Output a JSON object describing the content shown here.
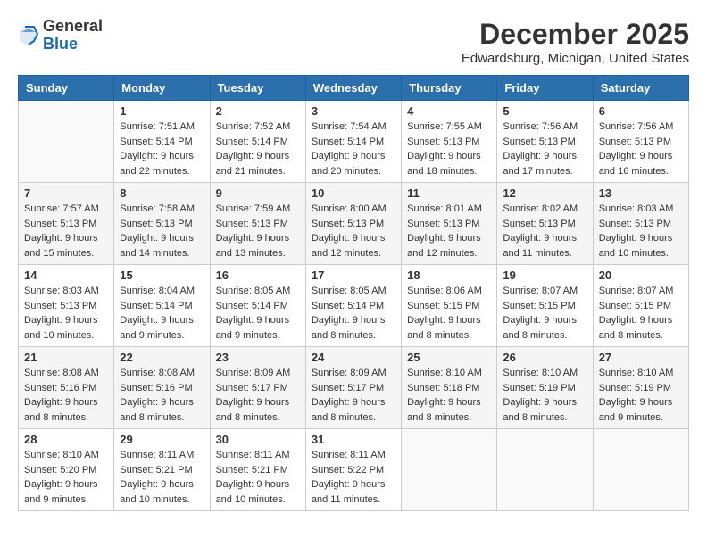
{
  "logo": {
    "general": "General",
    "blue": "Blue"
  },
  "title": {
    "month": "December 2025",
    "location": "Edwardsburg, Michigan, United States"
  },
  "weekdays": [
    "Sunday",
    "Monday",
    "Tuesday",
    "Wednesday",
    "Thursday",
    "Friday",
    "Saturday"
  ],
  "weeks": [
    [
      {
        "day": "",
        "info": ""
      },
      {
        "day": "1",
        "info": "Sunrise: 7:51 AM\nSunset: 5:14 PM\nDaylight: 9 hours\nand 22 minutes."
      },
      {
        "day": "2",
        "info": "Sunrise: 7:52 AM\nSunset: 5:14 PM\nDaylight: 9 hours\nand 21 minutes."
      },
      {
        "day": "3",
        "info": "Sunrise: 7:54 AM\nSunset: 5:14 PM\nDaylight: 9 hours\nand 20 minutes."
      },
      {
        "day": "4",
        "info": "Sunrise: 7:55 AM\nSunset: 5:13 PM\nDaylight: 9 hours\nand 18 minutes."
      },
      {
        "day": "5",
        "info": "Sunrise: 7:56 AM\nSunset: 5:13 PM\nDaylight: 9 hours\nand 17 minutes."
      },
      {
        "day": "6",
        "info": "Sunrise: 7:56 AM\nSunset: 5:13 PM\nDaylight: 9 hours\nand 16 minutes."
      }
    ],
    [
      {
        "day": "7",
        "info": "Sunrise: 7:57 AM\nSunset: 5:13 PM\nDaylight: 9 hours\nand 15 minutes."
      },
      {
        "day": "8",
        "info": "Sunrise: 7:58 AM\nSunset: 5:13 PM\nDaylight: 9 hours\nand 14 minutes."
      },
      {
        "day": "9",
        "info": "Sunrise: 7:59 AM\nSunset: 5:13 PM\nDaylight: 9 hours\nand 13 minutes."
      },
      {
        "day": "10",
        "info": "Sunrise: 8:00 AM\nSunset: 5:13 PM\nDaylight: 9 hours\nand 12 minutes."
      },
      {
        "day": "11",
        "info": "Sunrise: 8:01 AM\nSunset: 5:13 PM\nDaylight: 9 hours\nand 12 minutes."
      },
      {
        "day": "12",
        "info": "Sunrise: 8:02 AM\nSunset: 5:13 PM\nDaylight: 9 hours\nand 11 minutes."
      },
      {
        "day": "13",
        "info": "Sunrise: 8:03 AM\nSunset: 5:13 PM\nDaylight: 9 hours\nand 10 minutes."
      }
    ],
    [
      {
        "day": "14",
        "info": "Sunrise: 8:03 AM\nSunset: 5:13 PM\nDaylight: 9 hours\nand 10 minutes."
      },
      {
        "day": "15",
        "info": "Sunrise: 8:04 AM\nSunset: 5:14 PM\nDaylight: 9 hours\nand 9 minutes."
      },
      {
        "day": "16",
        "info": "Sunrise: 8:05 AM\nSunset: 5:14 PM\nDaylight: 9 hours\nand 9 minutes."
      },
      {
        "day": "17",
        "info": "Sunrise: 8:05 AM\nSunset: 5:14 PM\nDaylight: 9 hours\nand 8 minutes."
      },
      {
        "day": "18",
        "info": "Sunrise: 8:06 AM\nSunset: 5:15 PM\nDaylight: 9 hours\nand 8 minutes."
      },
      {
        "day": "19",
        "info": "Sunrise: 8:07 AM\nSunset: 5:15 PM\nDaylight: 9 hours\nand 8 minutes."
      },
      {
        "day": "20",
        "info": "Sunrise: 8:07 AM\nSunset: 5:15 PM\nDaylight: 9 hours\nand 8 minutes."
      }
    ],
    [
      {
        "day": "21",
        "info": "Sunrise: 8:08 AM\nSunset: 5:16 PM\nDaylight: 9 hours\nand 8 minutes."
      },
      {
        "day": "22",
        "info": "Sunrise: 8:08 AM\nSunset: 5:16 PM\nDaylight: 9 hours\nand 8 minutes."
      },
      {
        "day": "23",
        "info": "Sunrise: 8:09 AM\nSunset: 5:17 PM\nDaylight: 9 hours\nand 8 minutes."
      },
      {
        "day": "24",
        "info": "Sunrise: 8:09 AM\nSunset: 5:17 PM\nDaylight: 9 hours\nand 8 minutes."
      },
      {
        "day": "25",
        "info": "Sunrise: 8:10 AM\nSunset: 5:18 PM\nDaylight: 9 hours\nand 8 minutes."
      },
      {
        "day": "26",
        "info": "Sunrise: 8:10 AM\nSunset: 5:19 PM\nDaylight: 9 hours\nand 8 minutes."
      },
      {
        "day": "27",
        "info": "Sunrise: 8:10 AM\nSunset: 5:19 PM\nDaylight: 9 hours\nand 9 minutes."
      }
    ],
    [
      {
        "day": "28",
        "info": "Sunrise: 8:10 AM\nSunset: 5:20 PM\nDaylight: 9 hours\nand 9 minutes."
      },
      {
        "day": "29",
        "info": "Sunrise: 8:11 AM\nSunset: 5:21 PM\nDaylight: 9 hours\nand 10 minutes."
      },
      {
        "day": "30",
        "info": "Sunrise: 8:11 AM\nSunset: 5:21 PM\nDaylight: 9 hours\nand 10 minutes."
      },
      {
        "day": "31",
        "info": "Sunrise: 8:11 AM\nSunset: 5:22 PM\nDaylight: 9 hours\nand 11 minutes."
      },
      {
        "day": "",
        "info": ""
      },
      {
        "day": "",
        "info": ""
      },
      {
        "day": "",
        "info": ""
      }
    ]
  ]
}
